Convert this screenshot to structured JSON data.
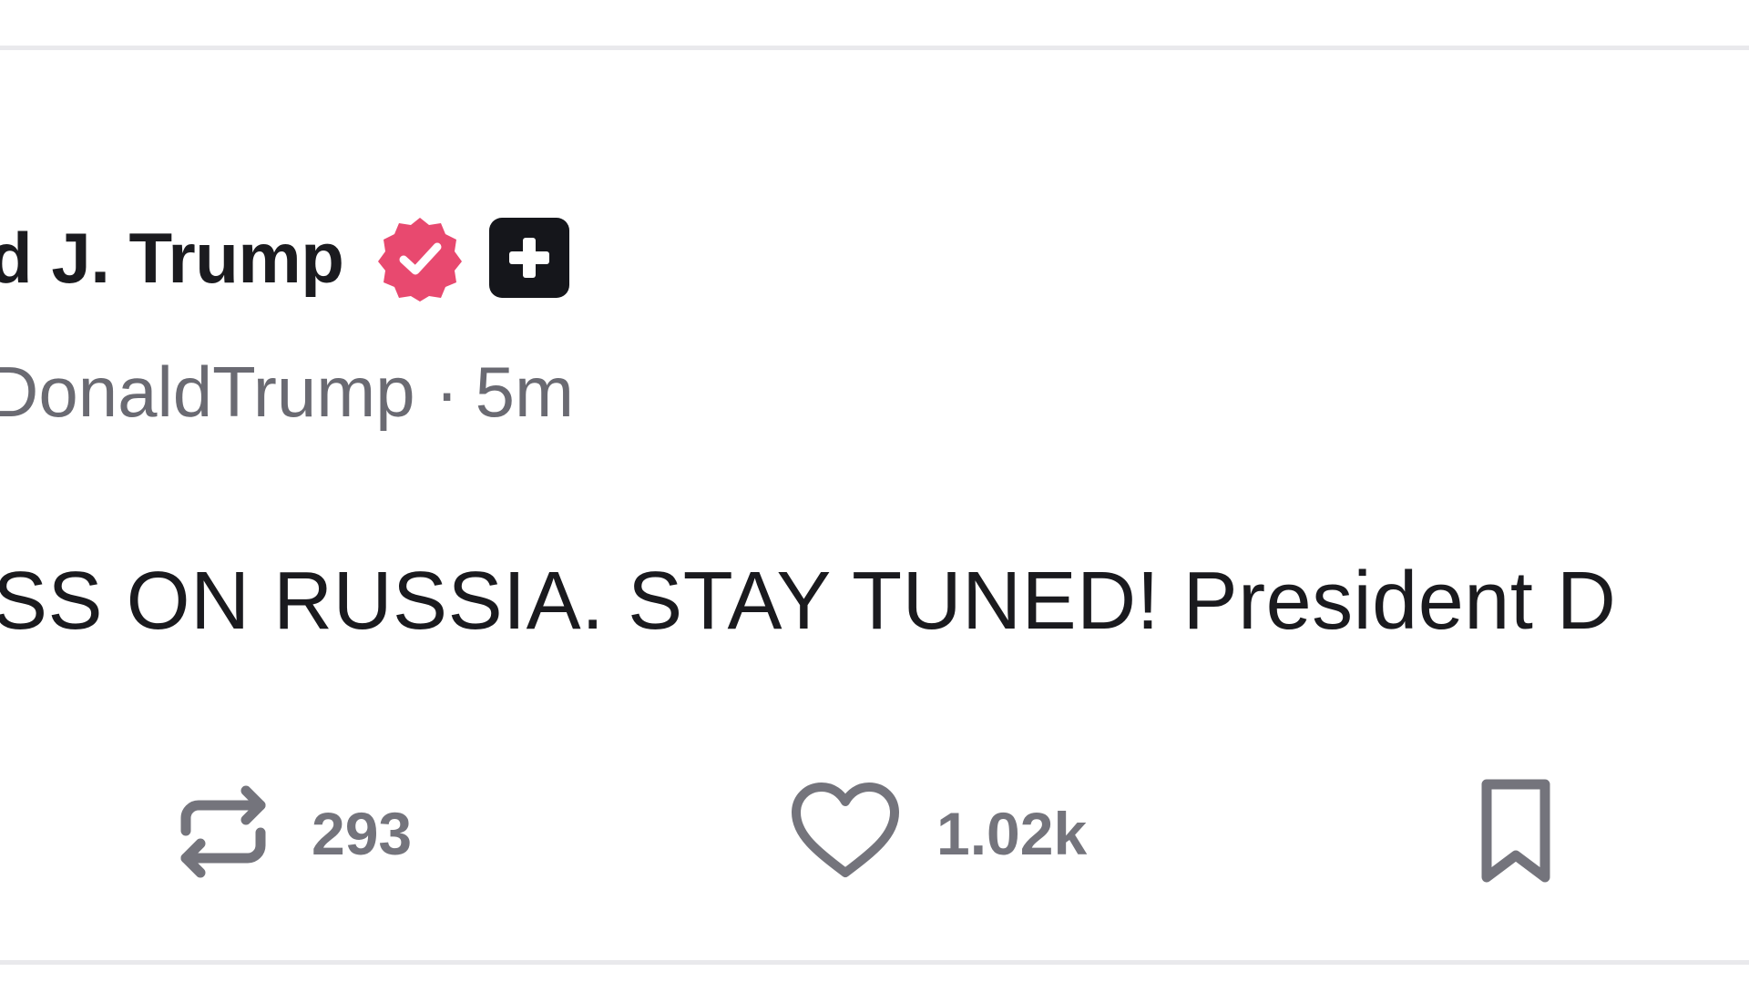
{
  "post": {
    "author_name": "d J. Trump",
    "handle": "DonaldTrump",
    "separator": "·",
    "time_ago": "5m",
    "body_text": "SS ON RUSSIA. STAY TUNED! President D",
    "badges": {
      "verified_color": "#e8496f",
      "plus_color": "#15161b"
    }
  },
  "actions": {
    "repost": {
      "icon": "repost-icon",
      "count": "293"
    },
    "like": {
      "icon": "heart-icon",
      "count": "1.02k"
    },
    "bookmark": {
      "icon": "bookmark-icon"
    }
  },
  "colors": {
    "text_primary": "#1a1a1e",
    "text_secondary": "#6a6a72",
    "action_gray": "#74747c",
    "divider": "#e9e9ec"
  }
}
